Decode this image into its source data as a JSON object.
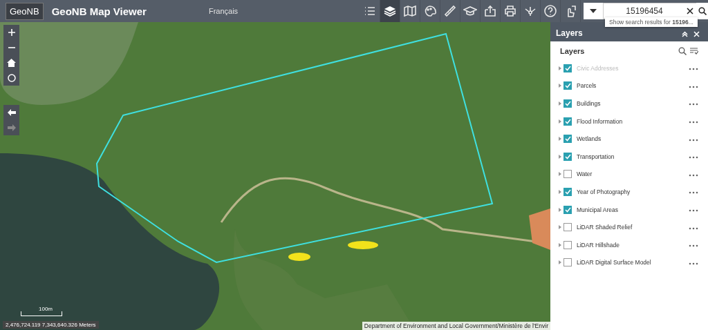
{
  "app": {
    "logo": "GeoNB",
    "title": "GeoNB Map Viewer",
    "language_link": "Français"
  },
  "toolbar": {
    "tools": [
      {
        "selected": false
      },
      {
        "selected": true
      },
      {
        "selected": false
      },
      {
        "selected": false
      },
      {
        "selected": false
      },
      {
        "selected": false
      },
      {
        "selected": false
      },
      {
        "selected": false
      },
      {
        "selected": false
      },
      {
        "selected": false
      },
      {
        "selected": false
      }
    ],
    "search": {
      "value": "15196454",
      "suggestion": "Show search results for **15196**..."
    }
  },
  "map": {
    "scale_label": "100m",
    "coordinates": "2,476,724.119 7,343,640.326 Meters",
    "attribution": "Department of Environment and Local Government/Ministère de l'Envir"
  },
  "layers_panel": {
    "title": "Layers",
    "heading": "Layers",
    "layers": [
      {
        "name": "Civic Addresses",
        "checked": true,
        "disabled": true
      },
      {
        "name": "Parcels",
        "checked": true,
        "disabled": false
      },
      {
        "name": "Buildings",
        "checked": true,
        "disabled": false
      },
      {
        "name": "Flood Information",
        "checked": true,
        "disabled": false
      },
      {
        "name": "Wetlands",
        "checked": true,
        "disabled": false
      },
      {
        "name": "Transportation",
        "checked": true,
        "disabled": false
      },
      {
        "name": "Water",
        "checked": false,
        "disabled": false
      },
      {
        "name": "Year of Photography",
        "checked": true,
        "disabled": false
      },
      {
        "name": "Municipal Areas",
        "checked": true,
        "disabled": false
      },
      {
        "name": "LiDAR Shaded Relief",
        "checked": false,
        "disabled": false
      },
      {
        "name": "LiDAR Hillshade",
        "checked": false,
        "disabled": false
      },
      {
        "name": "LiDAR Digital Surface Model",
        "checked": false,
        "disabled": false
      }
    ]
  }
}
